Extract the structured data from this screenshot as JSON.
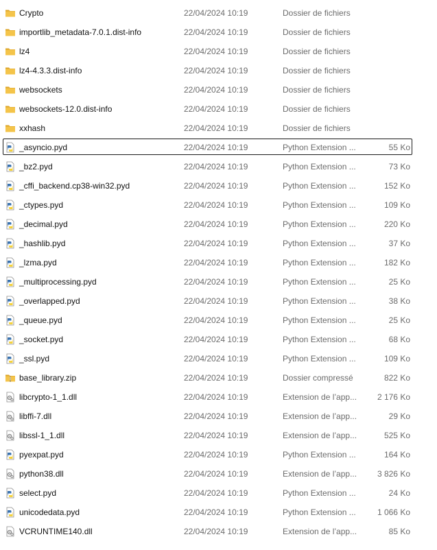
{
  "files": [
    {
      "name": "Crypto",
      "date": "22/04/2024 10:19",
      "type": "Dossier de fichiers",
      "size": "",
      "icon": "folder-icon"
    },
    {
      "name": "importlib_metadata-7.0.1.dist-info",
      "date": "22/04/2024 10:19",
      "type": "Dossier de fichiers",
      "size": "",
      "icon": "folder-icon"
    },
    {
      "name": "lz4",
      "date": "22/04/2024 10:19",
      "type": "Dossier de fichiers",
      "size": "",
      "icon": "folder-icon"
    },
    {
      "name": "lz4-4.3.3.dist-info",
      "date": "22/04/2024 10:19",
      "type": "Dossier de fichiers",
      "size": "",
      "icon": "folder-icon"
    },
    {
      "name": "websockets",
      "date": "22/04/2024 10:19",
      "type": "Dossier de fichiers",
      "size": "",
      "icon": "folder-icon"
    },
    {
      "name": "websockets-12.0.dist-info",
      "date": "22/04/2024 10:19",
      "type": "Dossier de fichiers",
      "size": "",
      "icon": "folder-icon"
    },
    {
      "name": "xxhash",
      "date": "22/04/2024 10:19",
      "type": "Dossier de fichiers",
      "size": "",
      "icon": "folder-icon"
    },
    {
      "name": "_asyncio.pyd",
      "date": "22/04/2024 10:19",
      "type": "Python Extension ...",
      "size": "55 Ko",
      "icon": "python-file-icon",
      "focused": true
    },
    {
      "name": "_bz2.pyd",
      "date": "22/04/2024 10:19",
      "type": "Python Extension ...",
      "size": "73 Ko",
      "icon": "python-file-icon"
    },
    {
      "name": "_cffi_backend.cp38-win32.pyd",
      "date": "22/04/2024 10:19",
      "type": "Python Extension ...",
      "size": "152 Ko",
      "icon": "python-file-icon"
    },
    {
      "name": "_ctypes.pyd",
      "date": "22/04/2024 10:19",
      "type": "Python Extension ...",
      "size": "109 Ko",
      "icon": "python-file-icon"
    },
    {
      "name": "_decimal.pyd",
      "date": "22/04/2024 10:19",
      "type": "Python Extension ...",
      "size": "220 Ko",
      "icon": "python-file-icon"
    },
    {
      "name": "_hashlib.pyd",
      "date": "22/04/2024 10:19",
      "type": "Python Extension ...",
      "size": "37 Ko",
      "icon": "python-file-icon"
    },
    {
      "name": "_lzma.pyd",
      "date": "22/04/2024 10:19",
      "type": "Python Extension ...",
      "size": "182 Ko",
      "icon": "python-file-icon"
    },
    {
      "name": "_multiprocessing.pyd",
      "date": "22/04/2024 10:19",
      "type": "Python Extension ...",
      "size": "25 Ko",
      "icon": "python-file-icon"
    },
    {
      "name": "_overlapped.pyd",
      "date": "22/04/2024 10:19",
      "type": "Python Extension ...",
      "size": "38 Ko",
      "icon": "python-file-icon"
    },
    {
      "name": "_queue.pyd",
      "date": "22/04/2024 10:19",
      "type": "Python Extension ...",
      "size": "25 Ko",
      "icon": "python-file-icon"
    },
    {
      "name": "_socket.pyd",
      "date": "22/04/2024 10:19",
      "type": "Python Extension ...",
      "size": "68 Ko",
      "icon": "python-file-icon"
    },
    {
      "name": "_ssl.pyd",
      "date": "22/04/2024 10:19",
      "type": "Python Extension ...",
      "size": "109 Ko",
      "icon": "python-file-icon"
    },
    {
      "name": "base_library.zip",
      "date": "22/04/2024 10:19",
      "type": "Dossier compressé",
      "size": "822 Ko",
      "icon": "zip-folder-icon"
    },
    {
      "name": "libcrypto-1_1.dll",
      "date": "22/04/2024 10:19",
      "type": "Extension de l’app...",
      "size": "2 176 Ko",
      "icon": "dll-file-icon"
    },
    {
      "name": "libffi-7.dll",
      "date": "22/04/2024 10:19",
      "type": "Extension de l’app...",
      "size": "29 Ko",
      "icon": "dll-file-icon"
    },
    {
      "name": "libssl-1_1.dll",
      "date": "22/04/2024 10:19",
      "type": "Extension de l’app...",
      "size": "525 Ko",
      "icon": "dll-file-icon"
    },
    {
      "name": "pyexpat.pyd",
      "date": "22/04/2024 10:19",
      "type": "Python Extension ...",
      "size": "164 Ko",
      "icon": "python-file-icon"
    },
    {
      "name": "python38.dll",
      "date": "22/04/2024 10:19",
      "type": "Extension de l’app...",
      "size": "3 826 Ko",
      "icon": "dll-file-icon"
    },
    {
      "name": "select.pyd",
      "date": "22/04/2024 10:19",
      "type": "Python Extension ...",
      "size": "24 Ko",
      "icon": "python-file-icon"
    },
    {
      "name": "unicodedata.pyd",
      "date": "22/04/2024 10:19",
      "type": "Python Extension ...",
      "size": "1 066 Ko",
      "icon": "python-file-icon"
    },
    {
      "name": "VCRUNTIME140.dll",
      "date": "22/04/2024 10:19",
      "type": "Extension de l’app...",
      "size": "85 Ko",
      "icon": "dll-file-icon"
    }
  ],
  "colors": {
    "folder": "#f4c44a",
    "folder_dark": "#dca52a",
    "python_blue": "#3a73b0",
    "python_yellow": "#f5d23c",
    "dll_gear": "#8a8a8a",
    "muted_text": "#6b6b6b"
  }
}
